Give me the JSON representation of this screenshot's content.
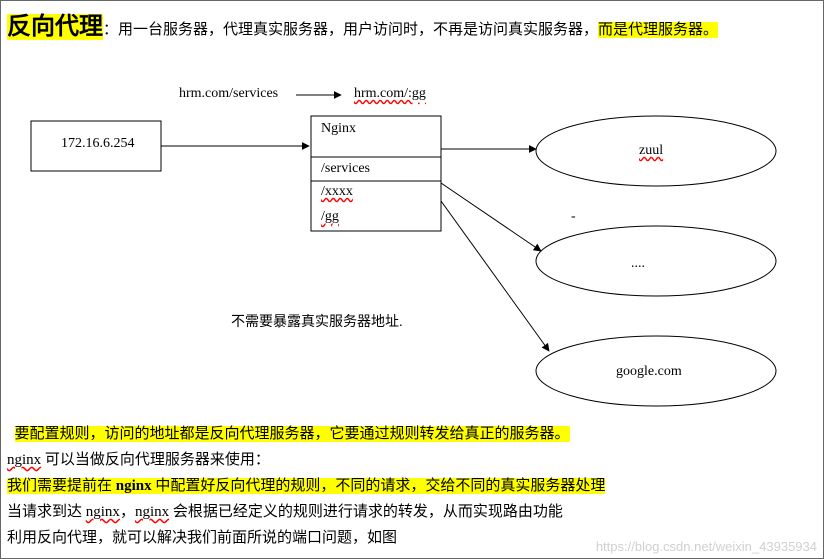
{
  "title": "反向代理",
  "colon": "：",
  "intro_plain": "用一台服务器，代理真实服务器，用户访问时，不再是访问真实服务器，",
  "intro_hl_tail": "而是代理服务器。",
  "diagram": {
    "client_ip": "172.16.6.254",
    "url_left": "hrm.com/services",
    "url_right": "hrm.com/:gg",
    "nginx_title": "Nginx",
    "route1": "/services",
    "route2": "/xxxx",
    "route3": "/gg",
    "node1": "zuul",
    "node2_dash": "-",
    "node2": "....",
    "node3": "google.com",
    "note": "不需要暴露真实服务器地址."
  },
  "body": {
    "l1_hl": "要配置规则，访问的地址都是反向代理服务器，它要通过规则转发给真正的服务器。",
    "l2_a": "nginx",
    "l2_b": " 可以当做反向代理服务器来使用：",
    "l3_a": "我们需要提前在 ",
    "l3_b": "nginx",
    "l3_c": " 中配置好反向代理的规则，不同的请求，交给不同的真实服务器处理",
    "l4_a": "当请求到达 ",
    "l4_b": "nginx",
    "l4_c": "，",
    "l4_d": "nginx",
    "l4_e": " 会根据已经定义的规则进行请求的转发，从而实现路由功能",
    "l5": "利用反向代理，就可以解决我们前面所说的端口问题，如图"
  },
  "watermark": "https://blog.csdn.net/weixin_43935934"
}
